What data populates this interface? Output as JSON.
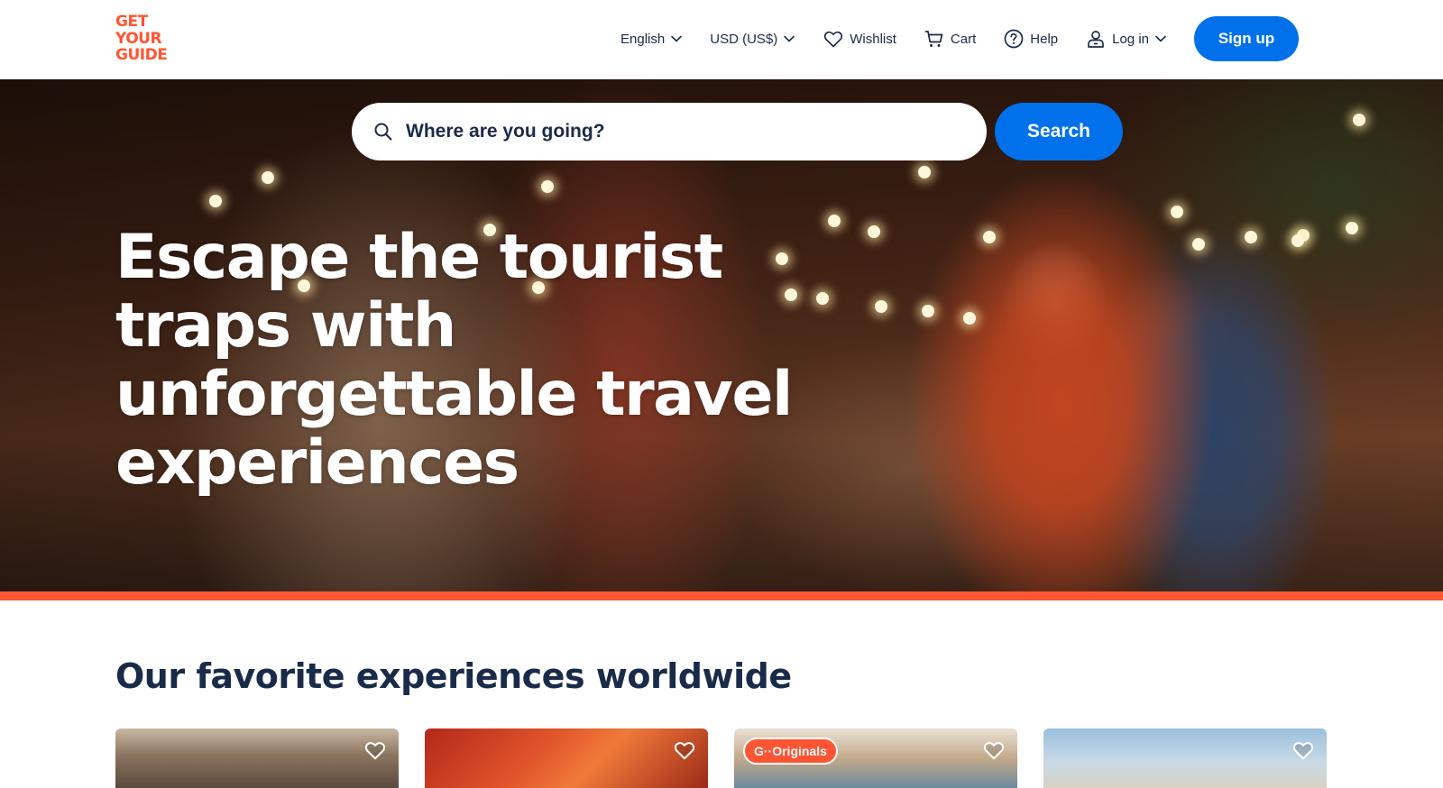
{
  "logo": {
    "lines": [
      "GET",
      "YOUR",
      "GUIDE"
    ],
    "color": "#ff5533"
  },
  "nav": {
    "language": {
      "label": "English",
      "icon": "chevron-down-icon"
    },
    "currency": {
      "label": "USD (US$)",
      "icon": "chevron-down-icon"
    },
    "wishlist": {
      "label": "Wishlist",
      "icon": "heart-icon"
    },
    "cart": {
      "label": "Cart",
      "icon": "cart-icon"
    },
    "help": {
      "label": "Help",
      "icon": "help-circle-icon"
    },
    "login": {
      "label": "Log in",
      "icon": "user-icon"
    },
    "signup": {
      "label": "Sign up"
    }
  },
  "search": {
    "placeholder": "Where are you going?",
    "value": "",
    "button_label": "Search",
    "icon": "search-icon"
  },
  "hero": {
    "headline": "Escape the tourist traps with unforgettable travel experiences",
    "accent_color": "#ff5533"
  },
  "section": {
    "title": "Our favorite experiences worldwide"
  },
  "cards": [
    {
      "badge": ""
    },
    {
      "badge": ""
    },
    {
      "badge": "G··Originals"
    },
    {
      "badge": ""
    }
  ],
  "colors": {
    "primary": "#0071eb",
    "text": "#1a2b49",
    "brand": "#ff5533"
  }
}
